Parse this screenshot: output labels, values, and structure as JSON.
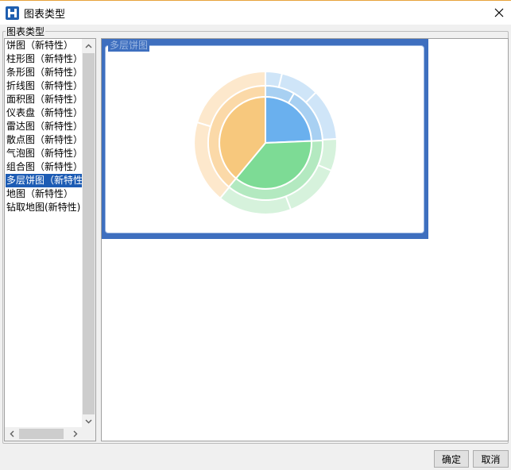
{
  "window": {
    "title": "图表类型"
  },
  "group_label": "图表类型",
  "chart_types": [
    "饼图（新特性）",
    "柱形图（新特性）",
    "条形图（新特性）",
    "折线图（新特性）",
    "面积图（新特性）",
    "仪表盘（新特性）",
    "雷达图（新特性）",
    "散点图（新特性）",
    "气泡图（新特性）",
    "组合图（新特性）",
    "多层饼图（新特性",
    "地图（新特性）",
    "钻取地图(新特性)"
  ],
  "selected_index": 10,
  "preview": {
    "title": "多层饼图"
  },
  "buttons": {
    "ok": "确定",
    "cancel": "取消"
  },
  "colors": {
    "accent": "#3e6fbf",
    "blue": "#6ab0ee",
    "green": "#7ddb95",
    "orange": "#f7c87d"
  }
}
